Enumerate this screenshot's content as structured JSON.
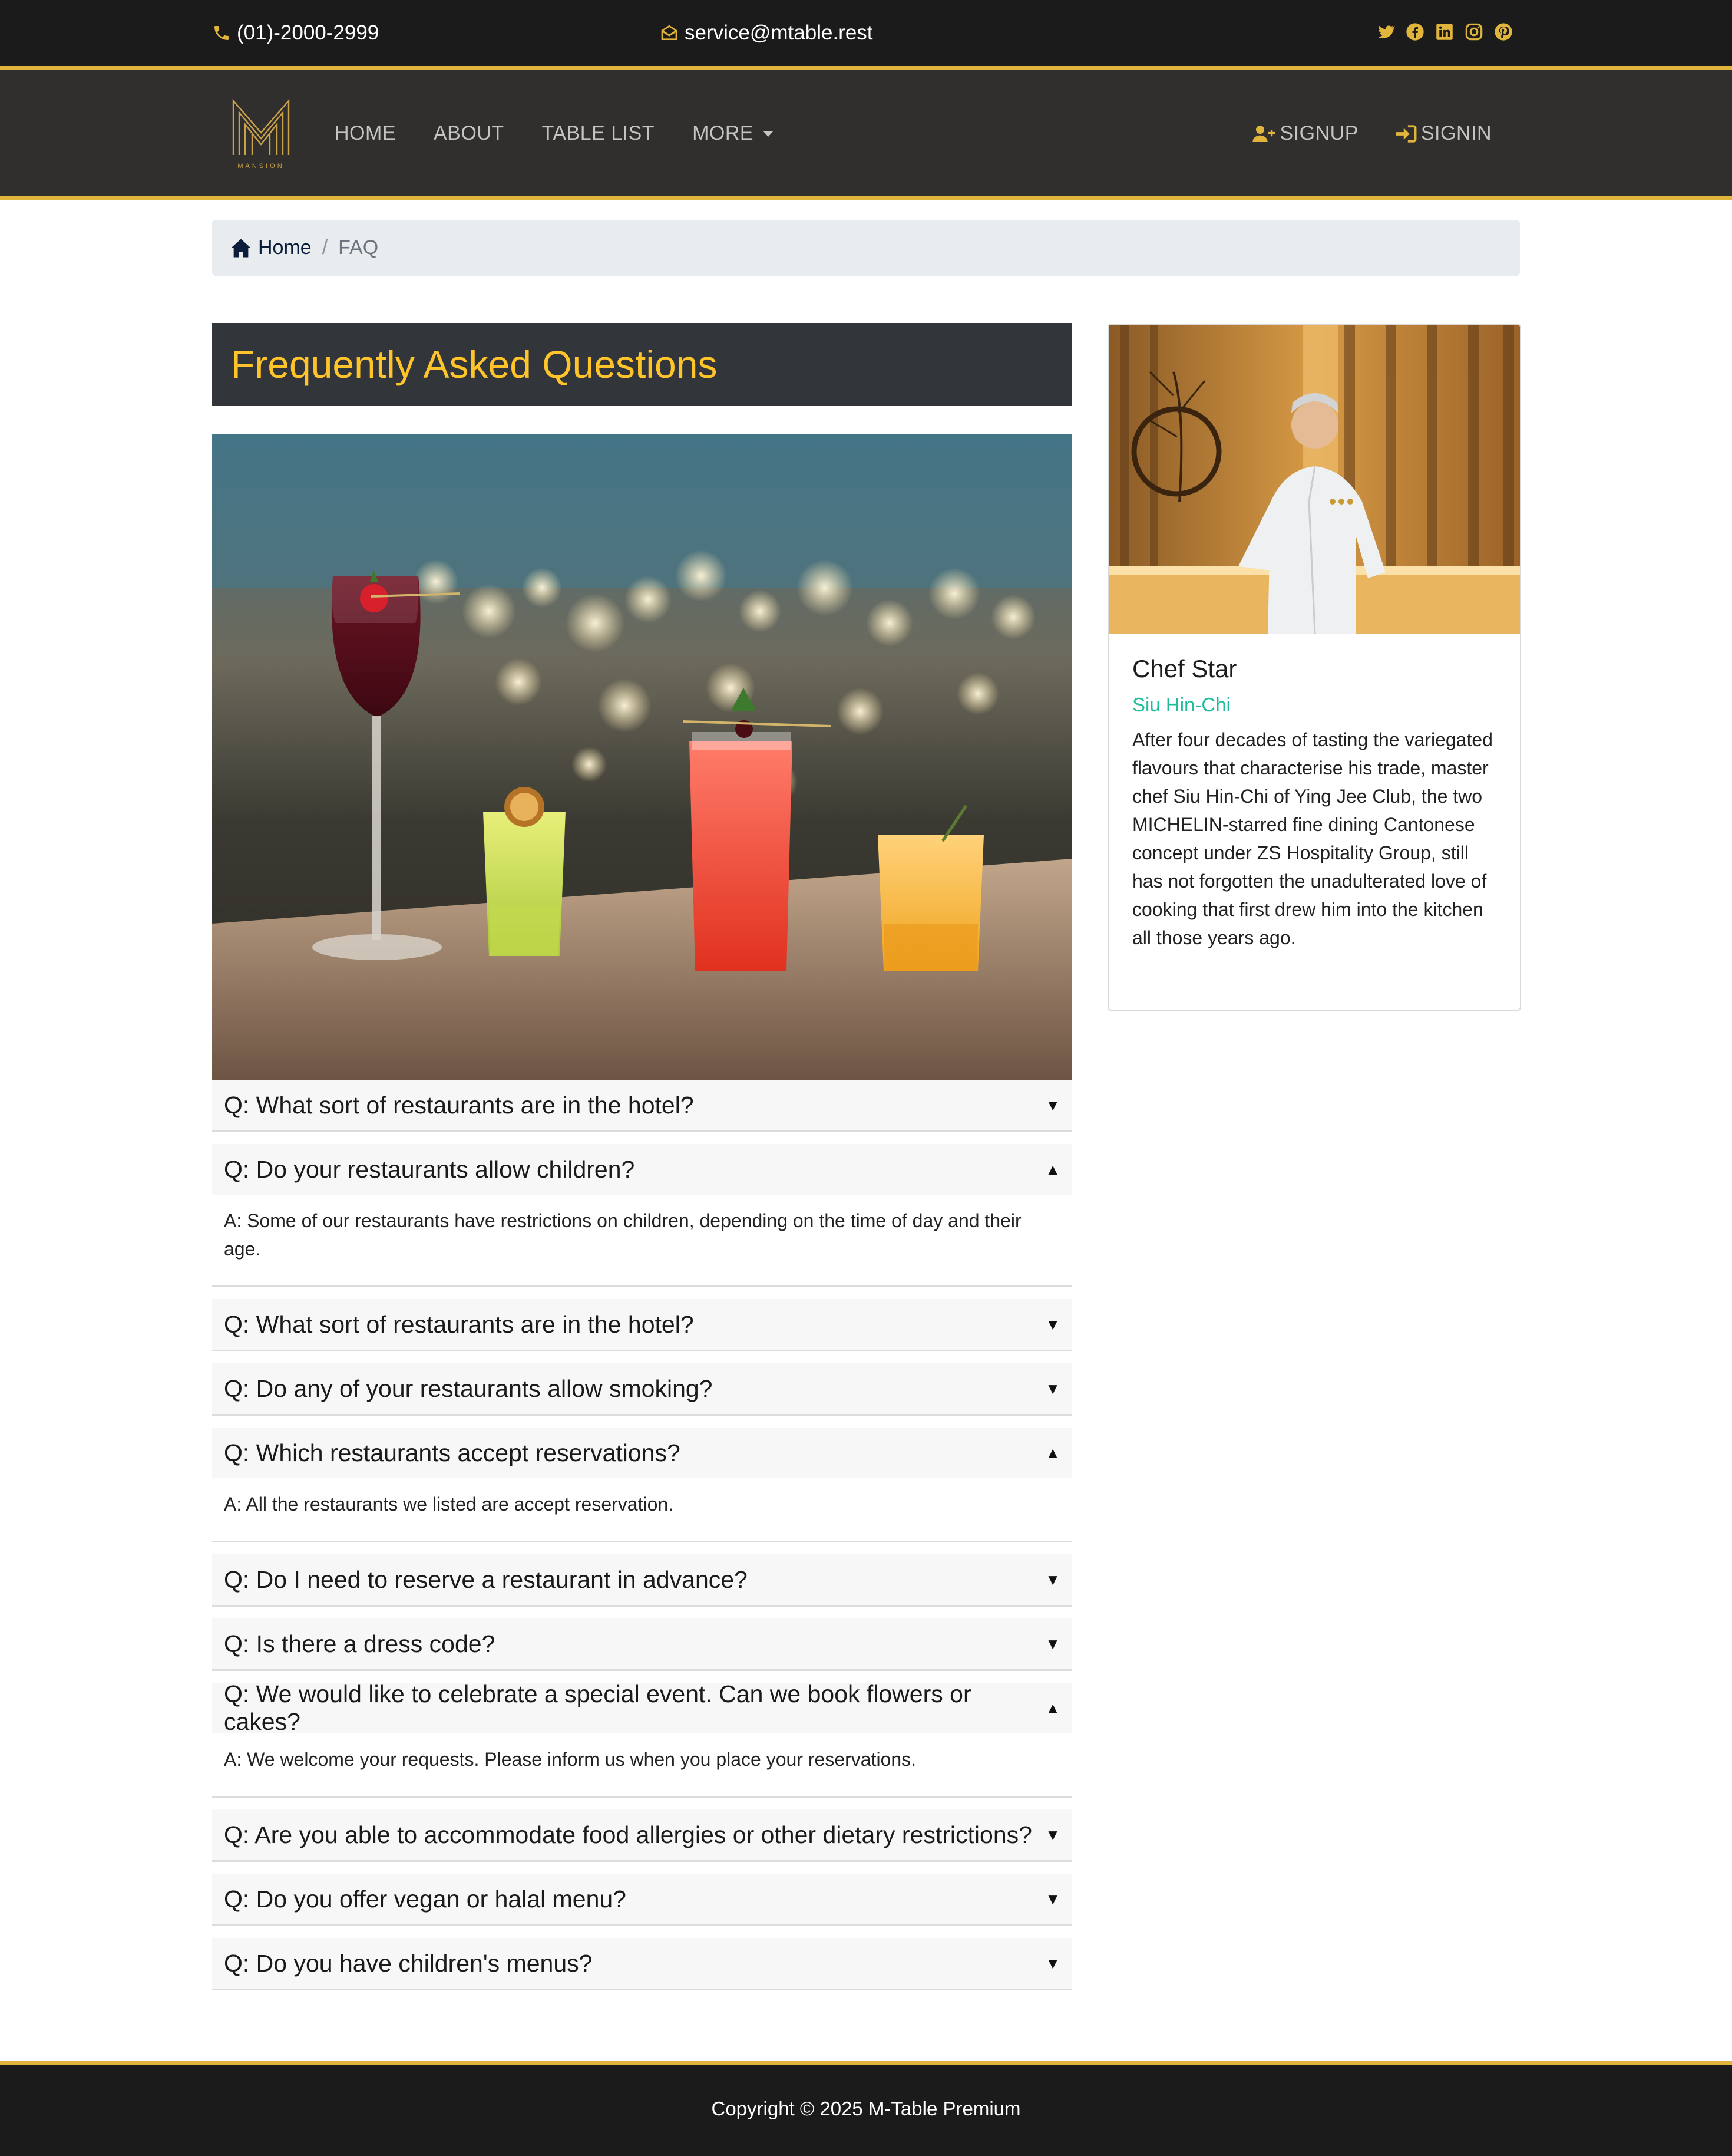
{
  "topbar": {
    "phone": "(01)-2000-2999",
    "email": "service@mtable.rest",
    "socials": [
      "twitter-icon",
      "facebook-icon",
      "linkedin-icon",
      "instagram-icon",
      "pinterest-icon"
    ]
  },
  "navbar": {
    "logo_text": "MANSION",
    "links": [
      "HOME",
      "ABOUT",
      "TABLE LIST",
      "MORE"
    ],
    "signup": "SIGNUP",
    "signin": "SIGNIN"
  },
  "breadcrumb": {
    "home": "Home",
    "separator": "/",
    "current": "FAQ"
  },
  "page": {
    "title": "Frequently Asked Questions"
  },
  "faq": [
    {
      "q": "Q: What sort of restaurants are in the hotel?",
      "a": "",
      "expanded": false
    },
    {
      "q": "Q: Do your restaurants allow children?",
      "a": "A: Some of our restaurants have restrictions on children, depending on the time of day and their age.",
      "expanded": true
    },
    {
      "q": "Q: What sort of restaurants are in the hotel?",
      "a": "",
      "expanded": false
    },
    {
      "q": "Q: Do any of your restaurants allow smoking?",
      "a": "",
      "expanded": false
    },
    {
      "q": "Q: Which restaurants accept reservations?",
      "a": "A: All the restaurants we listed are accept reservation.",
      "expanded": true
    },
    {
      "q": "Q: Do I need to reserve a restaurant in advance?",
      "a": "",
      "expanded": false
    },
    {
      "q": "Q: Is there a dress code?",
      "a": "",
      "expanded": false
    },
    {
      "q": "Q: We would like to celebrate a special event. Can we book flowers or cakes?",
      "a": "A: We welcome your requests. Please inform us when you place your reservations.",
      "expanded": true
    },
    {
      "q": "Q: Are you able to accommodate food allergies or other dietary restrictions?",
      "a": "",
      "expanded": false
    },
    {
      "q": "Q: Do you offer vegan or halal menu?",
      "a": "",
      "expanded": false
    },
    {
      "q": "Q: Do you have children's menus?",
      "a": "",
      "expanded": false
    }
  ],
  "chef": {
    "title": "Chef Star",
    "name": "Siu Hin-Chi",
    "description": "After four decades of tasting the variegated flavours that characterise his trade, master chef Siu Hin-Chi of Ying Jee Club, the two MICHELIN-starred fine dining Cantonese concept under ZS Hospitality Group, still has not forgotten the unadulterated love of cooking that first drew him into the kitchen all those years ago."
  },
  "footer": {
    "copyright": "Copyright © 2025 M-Table Premium"
  },
  "colors": {
    "accent_gold": "#e1b53c",
    "title_yellow": "#ffc42a",
    "chef_name_teal": "#1fbd9a"
  }
}
